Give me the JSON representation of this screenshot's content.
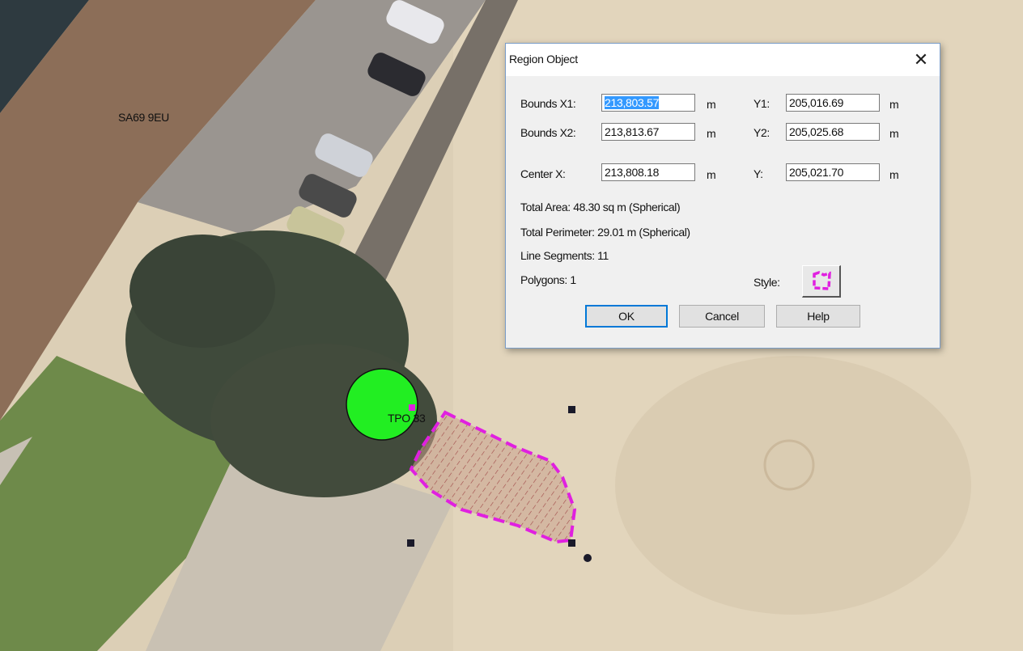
{
  "map": {
    "labels": {
      "postcode": "SA69 9EU",
      "tree": "TPO 33"
    },
    "colors": {
      "region_outline": "#e020e0",
      "tree_circle": "#22ee22",
      "selection_handle": "#1a1a2a"
    }
  },
  "dialog": {
    "title": "Region Object",
    "close_icon": "close-icon",
    "bounds_x1": {
      "label": "Bounds X1:",
      "value": "213,803.57",
      "unit": "m"
    },
    "bounds_y1": {
      "label": "Y1:",
      "value": "205,016.69",
      "unit": "m"
    },
    "bounds_x2": {
      "label": "Bounds X2:",
      "value": "213,813.67",
      "unit": "m"
    },
    "bounds_y2": {
      "label": "Y2:",
      "value": "205,025.68",
      "unit": "m"
    },
    "center_x": {
      "label": "Center X:",
      "value": "213,808.18",
      "unit": "m"
    },
    "center_y": {
      "label": "Y:",
      "value": "205,021.70",
      "unit": "m"
    },
    "total_area": "Total Area:  48.30 sq m (Spherical)",
    "total_perimeter": "Total Perimeter:  29.01 m (Spherical)",
    "line_segments": "Line Segments:  11",
    "polygons": "Polygons:  1",
    "style_label": "Style:",
    "style_icon": "region-style-icon",
    "buttons": {
      "ok": "OK",
      "cancel": "Cancel",
      "help": "Help"
    }
  }
}
